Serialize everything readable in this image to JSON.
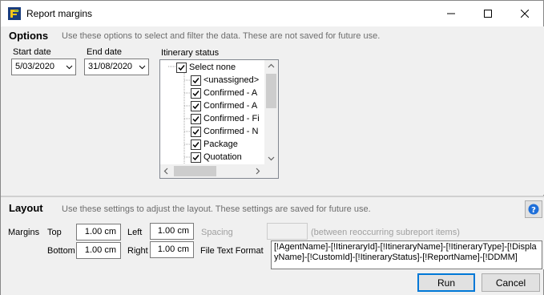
{
  "window": {
    "title": "Report margins"
  },
  "options": {
    "heading": "Options",
    "hint": "Use these options to select and filter the data.  These are not saved for future use.",
    "start_date_label": "Start date",
    "start_date_value": "5/03/2020",
    "end_date_label": "End date",
    "end_date_value": "31/08/2020",
    "itinerary_status_label": "Itinerary status",
    "itinerary_items": [
      {
        "label": "Select none",
        "checked": true
      },
      {
        "label": "<unassigned>",
        "checked": true
      },
      {
        "label": "Confirmed - A",
        "checked": true
      },
      {
        "label": "Confirmed - A",
        "checked": true
      },
      {
        "label": "Confirmed - Fi",
        "checked": true
      },
      {
        "label": "Confirmed - N",
        "checked": true
      },
      {
        "label": "Package",
        "checked": true
      },
      {
        "label": "Quotation",
        "checked": true
      }
    ]
  },
  "layout": {
    "heading": "Layout",
    "hint": "Use these settings to adjust the layout. These settings are saved for future use.",
    "margins_label": "Margins",
    "top_label": "Top",
    "top_value": "1.00 cm",
    "bottom_label": "Bottom",
    "bottom_value": "1.00 cm",
    "left_label": "Left",
    "left_value": "1.00 cm",
    "right_label": "Right",
    "right_value": "1.00 cm",
    "spacing_label": "Spacing",
    "spacing_value": "",
    "spacing_hint": "(between reoccurring subreport items)",
    "file_text_format_label": "File Text Format",
    "file_text_format_value": "[!AgentName]-[!ItineraryId]-[!ItineraryName]-[!ItineraryType]-[!DisplayName]-[!CustomId]-[!ItineraryStatus]-[!ReportName]-[!DDMM]"
  },
  "buttons": {
    "run": "Run",
    "cancel": "Cancel"
  },
  "colors": {
    "accent": "#0078d7",
    "hint_text": "#6d6d6d",
    "help_icon": "#1e6fd9"
  }
}
